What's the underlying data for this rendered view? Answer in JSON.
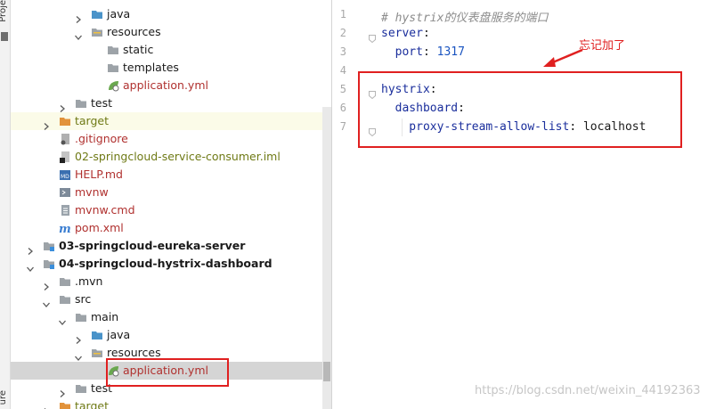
{
  "stripe": {
    "label_top": "Proje",
    "label_bottom": "ure"
  },
  "tree": [
    {
      "depth": 4,
      "arrow": "right",
      "icon": "folder-blue",
      "label": "java",
      "style": "normal"
    },
    {
      "depth": 4,
      "arrow": "down",
      "icon": "folder-res",
      "label": "resources",
      "style": "normal"
    },
    {
      "depth": 5,
      "arrow": "none",
      "icon": "folder",
      "label": "static",
      "style": "normal"
    },
    {
      "depth": 5,
      "arrow": "none",
      "icon": "folder",
      "label": "templates",
      "style": "normal"
    },
    {
      "depth": 5,
      "arrow": "none",
      "icon": "spring",
      "label": "application.yml",
      "style": "red"
    },
    {
      "depth": 3,
      "arrow": "right",
      "icon": "folder",
      "label": "test",
      "style": "normal"
    },
    {
      "depth": 2,
      "arrow": "right",
      "icon": "folder-orange",
      "label": "target",
      "style": "olive",
      "bg": "#fbfbe8"
    },
    {
      "depth": 2,
      "arrow": "none",
      "icon": "git",
      "label": ".gitignore",
      "style": "red"
    },
    {
      "depth": 2,
      "arrow": "none",
      "icon": "iml",
      "label": "02-springcloud-service-consumer.iml",
      "style": "olive"
    },
    {
      "depth": 2,
      "arrow": "none",
      "icon": "md",
      "label": "HELP.md",
      "style": "red"
    },
    {
      "depth": 2,
      "arrow": "none",
      "icon": "terminal",
      "label": "mvnw",
      "style": "red"
    },
    {
      "depth": 2,
      "arrow": "none",
      "icon": "text",
      "label": "mvnw.cmd",
      "style": "red"
    },
    {
      "depth": 2,
      "arrow": "none",
      "icon": "maven",
      "label": "pom.xml",
      "style": "red"
    },
    {
      "depth": 1,
      "arrow": "right",
      "icon": "module",
      "label": "03-springcloud-eureka-server",
      "style": "bold"
    },
    {
      "depth": 1,
      "arrow": "down",
      "icon": "module",
      "label": "04-springcloud-hystrix-dashboard",
      "style": "bold"
    },
    {
      "depth": 2,
      "arrow": "right",
      "icon": "folder",
      "label": ".mvn",
      "style": "normal"
    },
    {
      "depth": 2,
      "arrow": "down",
      "icon": "folder",
      "label": "src",
      "style": "normal"
    },
    {
      "depth": 3,
      "arrow": "down",
      "icon": "folder",
      "label": "main",
      "style": "normal"
    },
    {
      "depth": 4,
      "arrow": "right",
      "icon": "folder-blue",
      "label": "java",
      "style": "normal"
    },
    {
      "depth": 4,
      "arrow": "down",
      "icon": "folder-res",
      "label": "resources",
      "style": "normal"
    },
    {
      "depth": 5,
      "arrow": "none",
      "icon": "spring",
      "label": "application.yml",
      "style": "red",
      "selected": true
    },
    {
      "depth": 3,
      "arrow": "right",
      "icon": "folder",
      "label": "test",
      "style": "normal"
    },
    {
      "depth": 2,
      "arrow": "right",
      "icon": "folder-orange",
      "label": "target",
      "style": "olive"
    }
  ],
  "editor": {
    "line_numbers": [
      "1",
      "2",
      "3",
      "4",
      "5",
      "6",
      "7"
    ],
    "lines": [
      [
        {
          "t": "# hystrix的仪表盘服务的端口",
          "c": "comment"
        }
      ],
      [
        {
          "t": "server",
          "c": "key"
        },
        {
          "t": ":",
          "c": "val"
        }
      ],
      [
        {
          "t": "  port",
          "c": "key"
        },
        {
          "t": ": ",
          "c": "val"
        },
        {
          "t": "1317",
          "c": "num"
        }
      ],
      [],
      [
        {
          "t": "hystrix",
          "c": "key"
        },
        {
          "t": ":",
          "c": "val"
        }
      ],
      [
        {
          "t": "  dashboard",
          "c": "key"
        },
        {
          "t": ":",
          "c": "val"
        }
      ],
      [
        {
          "t": "    proxy-stream-allow-list",
          "c": "key"
        },
        {
          "t": ": ",
          "c": "val"
        },
        {
          "t": "localhost",
          "c": "val"
        }
      ]
    ]
  },
  "annotation": {
    "note": "忘记加了"
  },
  "watermark": "https://blog.csdn.net/weixin_44192363",
  "colors": {
    "annotation_red": "#e02020",
    "selection": "#d5d5d5",
    "key_blue": "#1a2e9c"
  }
}
